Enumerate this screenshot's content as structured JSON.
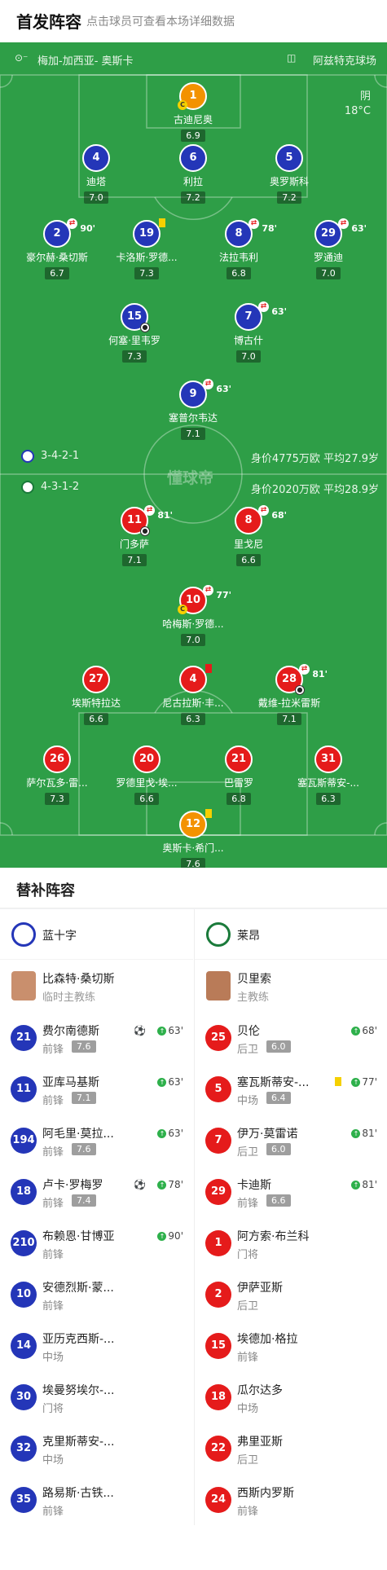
{
  "header": {
    "title": "首发阵容",
    "hint": "点击球员可查看本场详细数据"
  },
  "pitch": {
    "home_venue": "梅加-加西亚- 奥斯卡",
    "away_venue": "阿兹特克球场",
    "weather": "阴",
    "temperature": "18°C",
    "watermark": "懂球帝",
    "home_formation": "3-4-2-1",
    "home_value": "身价4775万欧 平均27.9岁",
    "away_formation": "4-3-1-2",
    "away_value": "身价2020万欧 平均28.9岁",
    "home_players": [
      {
        "num": "1",
        "name": "古迪尼奥",
        "rating": "6.9",
        "captain": true
      },
      {
        "num": "4",
        "name": "迪塔",
        "rating": "7.0"
      },
      {
        "num": "6",
        "name": "利拉",
        "rating": "7.2"
      },
      {
        "num": "5",
        "name": "奥罗斯科",
        "rating": "7.2"
      },
      {
        "num": "2",
        "name": "豪尔赫·桑切斯",
        "rating": "6.7",
        "sub": "90'"
      },
      {
        "num": "19",
        "name": "卡洛斯·罗德...",
        "rating": "7.3",
        "card": "yellow"
      },
      {
        "num": "8",
        "name": "法拉韦利",
        "rating": "6.8",
        "sub": "78'"
      },
      {
        "num": "29",
        "name": "罗通迪",
        "rating": "7.0",
        "sub": "63'"
      },
      {
        "num": "15",
        "name": "何塞·里韦罗",
        "rating": "7.3",
        "ball": true
      },
      {
        "num": "7",
        "name": "博古什",
        "rating": "7.0",
        "sub": "63'"
      },
      {
        "num": "9",
        "name": "塞普尔韦达",
        "rating": "7.1",
        "sub": "63'"
      }
    ],
    "away_players": [
      {
        "num": "11",
        "name": "门多萨",
        "rating": "7.1",
        "sub": "81'",
        "ball": true
      },
      {
        "num": "8",
        "name": "里戈尼",
        "rating": "6.6",
        "sub": "68'"
      },
      {
        "num": "10",
        "name": "哈梅斯·罗德...",
        "rating": "7.0",
        "sub": "77'",
        "captain": true
      },
      {
        "num": "27",
        "name": "埃斯特拉达",
        "rating": "6.6"
      },
      {
        "num": "4",
        "name": "尼古拉斯·丰...",
        "rating": "6.3",
        "card": "red"
      },
      {
        "num": "28",
        "name": "戴维-拉米雷斯",
        "rating": "7.1",
        "sub": "81'",
        "ball": true
      },
      {
        "num": "26",
        "name": "萨尔瓦多·雷...",
        "rating": "7.3"
      },
      {
        "num": "20",
        "name": "罗德里戈·埃...",
        "rating": "6.6"
      },
      {
        "num": "21",
        "name": "巴雷罗",
        "rating": "6.8"
      },
      {
        "num": "31",
        "name": "塞瓦斯蒂安-...",
        "rating": "6.3"
      },
      {
        "num": "12",
        "name": "奥斯卡·希门...",
        "rating": "7.6",
        "card": "yellow"
      }
    ]
  },
  "subs": {
    "title": "替补阵容",
    "home": {
      "team": "蓝十字",
      "coach_name": "比森特·桑切斯",
      "coach_role": "临时主教练",
      "players": [
        {
          "num": "21",
          "name": "费尔南德斯",
          "pos": "前锋",
          "rating": "7.6",
          "in": "63'",
          "ball": true
        },
        {
          "num": "11",
          "name": "亚库马基斯",
          "pos": "前锋",
          "rating": "7.1",
          "in": "63'"
        },
        {
          "num": "194",
          "name": "阿毛里·莫拉...",
          "pos": "前锋",
          "rating": "7.6",
          "in": "63'"
        },
        {
          "num": "18",
          "name": "卢卡·罗梅罗",
          "pos": "前锋",
          "rating": "7.4",
          "in": "78'",
          "ball": true
        },
        {
          "num": "210",
          "name": "布赖恩·甘博亚",
          "pos": "前锋",
          "in": "90'"
        },
        {
          "num": "10",
          "name": "安德烈斯·蒙...",
          "pos": "前锋"
        },
        {
          "num": "14",
          "name": "亚历克西斯-...",
          "pos": "中场"
        },
        {
          "num": "30",
          "name": "埃曼努埃尔-...",
          "pos": "门将"
        },
        {
          "num": "32",
          "name": "克里斯蒂安-...",
          "pos": "中场"
        },
        {
          "num": "35",
          "name": "路易斯·古铁...",
          "pos": "前锋"
        }
      ]
    },
    "away": {
      "team": "莱昂",
      "coach_name": "贝里索",
      "coach_role": "主教练",
      "players": [
        {
          "num": "25",
          "name": "贝伦",
          "pos": "后卫",
          "rating": "6.0",
          "in": "68'"
        },
        {
          "num": "5",
          "name": "塞瓦斯蒂安-...",
          "pos": "中场",
          "rating": "6.4",
          "in": "77'",
          "card": true
        },
        {
          "num": "7",
          "name": "伊万·莫雷诺",
          "pos": "后卫",
          "rating": "6.0",
          "in": "81'"
        },
        {
          "num": "29",
          "name": "卡迪斯",
          "pos": "前锋",
          "rating": "6.6",
          "in": "81'"
        },
        {
          "num": "1",
          "name": "阿方索·布兰科",
          "pos": "门将"
        },
        {
          "num": "2",
          "name": "伊萨亚斯",
          "pos": "后卫"
        },
        {
          "num": "15",
          "name": "埃德加·格拉",
          "pos": "前锋"
        },
        {
          "num": "18",
          "name": "瓜尔达多",
          "pos": "中场"
        },
        {
          "num": "22",
          "name": "弗里亚斯",
          "pos": "后卫"
        },
        {
          "num": "24",
          "name": "西斯内罗斯",
          "pos": "前锋"
        }
      ]
    }
  }
}
